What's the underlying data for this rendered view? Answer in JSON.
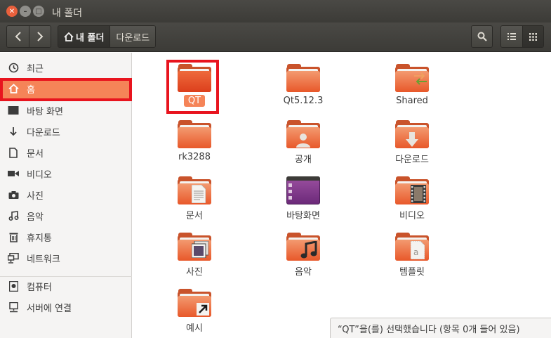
{
  "window": {
    "title": "내 폴더"
  },
  "toolbar": {
    "breadcrumbs": [
      {
        "label": "내 폴더",
        "active": true
      },
      {
        "label": "다운로드",
        "active": false
      }
    ]
  },
  "sidebar": {
    "items": [
      {
        "label": "최근",
        "icon": "clock-icon"
      },
      {
        "label": "홈",
        "icon": "home-icon",
        "selected": true
      },
      {
        "label": "바탕 화면",
        "icon": "desktop-icon"
      },
      {
        "label": "다운로드",
        "icon": "download-icon"
      },
      {
        "label": "문서",
        "icon": "document-icon"
      },
      {
        "label": "비디오",
        "icon": "video-icon"
      },
      {
        "label": "사진",
        "icon": "camera-icon"
      },
      {
        "label": "음악",
        "icon": "music-icon"
      },
      {
        "label": "휴지통",
        "icon": "trash-icon"
      },
      {
        "label": "네트워크",
        "icon": "network-icon"
      },
      {
        "label": "컴퓨터",
        "icon": "computer-icon"
      },
      {
        "label": "서버에 연결",
        "icon": "server-icon"
      }
    ]
  },
  "files": [
    {
      "name": "QT",
      "emblem": "none",
      "selected": true
    },
    {
      "name": "Qt5.12.3",
      "emblem": "none"
    },
    {
      "name": "Shared",
      "emblem": "shared-arrows-icon"
    },
    {
      "name": "rk3288",
      "emblem": "none"
    },
    {
      "name": "공개",
      "emblem": "person-icon"
    },
    {
      "name": "다운로드",
      "emblem": "download-arrow-icon"
    },
    {
      "name": "문서",
      "emblem": "document-icon"
    },
    {
      "name": "바탕화면",
      "emblem": "desktop-icon"
    },
    {
      "name": "비디오",
      "emblem": "film-icon"
    },
    {
      "name": "사진",
      "emblem": "photo-icon"
    },
    {
      "name": "음악",
      "emblem": "music-note-icon"
    },
    {
      "name": "템플릿",
      "emblem": "template-icon"
    },
    {
      "name": "예시",
      "emblem": "link-arrow-icon"
    }
  ],
  "status": {
    "text": "“QT”을(를) 선택했습니다  (항목 0개 들어 있음)"
  },
  "colors": {
    "accent": "#f58458",
    "highlight": "#e8141e"
  }
}
